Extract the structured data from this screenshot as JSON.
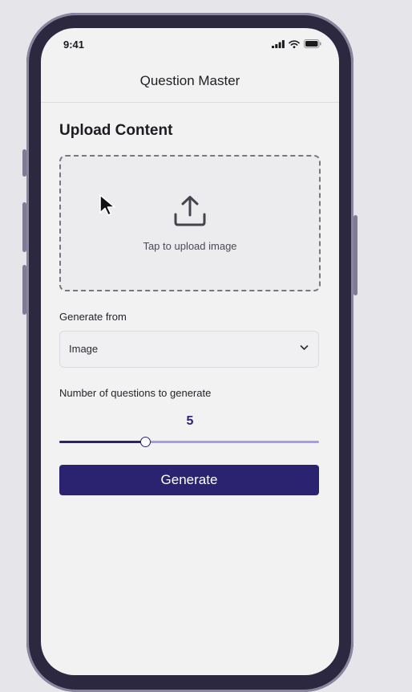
{
  "status_bar": {
    "time": "9:41",
    "icons": [
      "cellular-signal-icon",
      "wifi-icon",
      "battery-icon"
    ]
  },
  "header": {
    "title": "Question Master"
  },
  "upload": {
    "section_title": "Upload Content",
    "label": "Tap to upload image",
    "icon": "upload-icon"
  },
  "source_select": {
    "label": "Generate from",
    "value": "Image",
    "icon": "chevron-down-icon"
  },
  "question_count": {
    "label": "Number of questions to generate",
    "value": "5",
    "fraction": 0.33
  },
  "actions": {
    "generate_label": "Generate"
  },
  "colors": {
    "accent": "#2b2370",
    "accent_light": "#a49ce6",
    "frame": "#2c2840",
    "screen": "#f2f2f3",
    "background": "#e6e5ea"
  }
}
